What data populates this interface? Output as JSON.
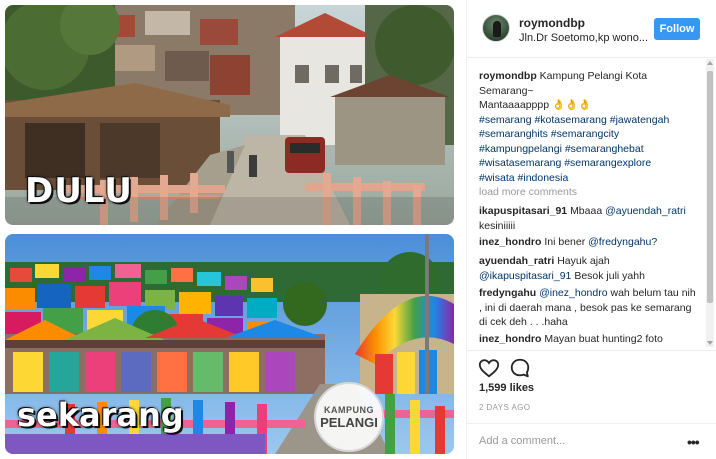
{
  "post": {
    "top_caption": "DULU",
    "bottom_caption": "sekarang",
    "logo": {
      "line1": "KAMPUNG",
      "line2": "PELANGI"
    }
  },
  "header": {
    "username": "roymondbp",
    "location": "Jln.Dr Soetomo,kp wono...",
    "follow_label": "Follow",
    "follow_color": "#3897f0"
  },
  "caption": {
    "user": "roymondbp",
    "text": "Kampung Pelangi Kota Semarang~",
    "text2": "Mantaaaapppp 👌👌👌",
    "hashtags": [
      "#semarang #kotasemarang #jawatengah",
      "#semaranghits #semarangcity",
      "#kampungpelangi #semaranghebat",
      "#wisatasemarang #semarangexplore",
      "#wisata #indonesia"
    ]
  },
  "load_more": "load more comments",
  "comments": [
    {
      "user": "ikapuspitasari_91",
      "pre": "",
      "mention": "@ayuendah_ratri",
      "text": "kesiniiiii",
      "pre_text": "Mbaaa"
    },
    {
      "user": "inez_hondro",
      "pre_text": "Ini bener",
      "mention": "@fredyngahu?",
      "text": ""
    },
    {
      "user": "ayuendah_ratri",
      "pre_text": "Hayuk ajah",
      "mention": "@ikapuspitasari_91",
      "text": "Besok juli yahh"
    },
    {
      "user": "fredyngahu",
      "pre_text": "",
      "mention": "@inez_hondro",
      "text": "wah belum tau nih , ini di daerah mana , besok pas ke semarang di cek deh . . .haha"
    },
    {
      "user": "inez_hondro",
      "pre_text": "Mayan buat hunting2 foto",
      "mention": "",
      "text": ""
    }
  ],
  "likes": "1,599 likes",
  "time_ago": "2 DAYS AGO",
  "add_comment_placeholder": "Add a comment...",
  "more_label": "•••"
}
